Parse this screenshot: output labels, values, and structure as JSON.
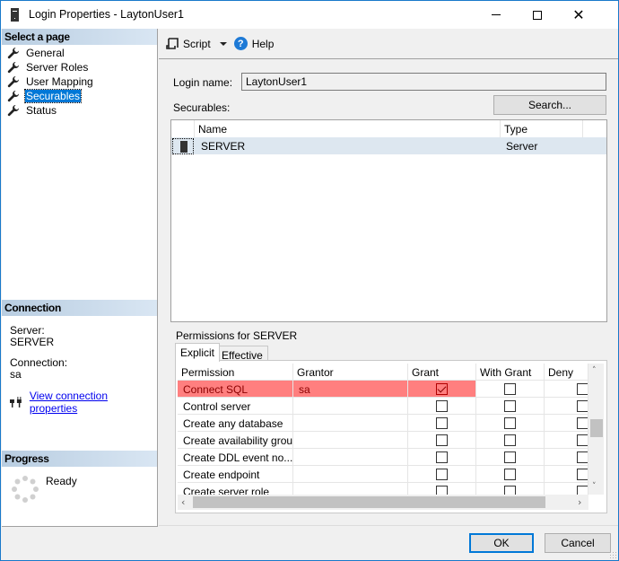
{
  "window": {
    "title": "Login Properties - LaytonUser1",
    "minimize_label": "Minimize",
    "maximize_label": "Maximize",
    "close_label": "Close"
  },
  "sidebar": {
    "select_page_heading": "Select a page",
    "items": [
      {
        "label": "General",
        "icon": "wrench-icon",
        "selected": false
      },
      {
        "label": "Server Roles",
        "icon": "wrench-icon",
        "selected": false
      },
      {
        "label": "User Mapping",
        "icon": "wrench-icon",
        "selected": false
      },
      {
        "label": "Securables",
        "icon": "wrench-icon",
        "selected": true
      },
      {
        "label": "Status",
        "icon": "wrench-icon",
        "selected": false
      }
    ],
    "connection": {
      "heading": "Connection",
      "server_label": "Server:",
      "server_value": "SERVER",
      "connection_label": "Connection:",
      "connection_value": "sa",
      "view_link": "View connection properties"
    },
    "progress": {
      "heading": "Progress",
      "status": "Ready"
    }
  },
  "toolbar": {
    "script_label": "Script",
    "help_label": "Help"
  },
  "form": {
    "login_name_label": "Login name:",
    "login_name_value": "LaytonUser1",
    "securables_label": "Securables:",
    "search_button": "Search..."
  },
  "securables_grid": {
    "columns": [
      "Name",
      "Type"
    ],
    "rows": [
      {
        "icon": "server-icon",
        "name": "SERVER",
        "type": "Server"
      }
    ]
  },
  "permissions": {
    "label": "Permissions for SERVER",
    "tabs": [
      {
        "label": "Explicit",
        "active": true
      },
      {
        "label": "Effective",
        "active": false
      }
    ],
    "columns": [
      "Permission",
      "Grantor",
      "Grant",
      "With Grant",
      "Deny"
    ],
    "rows": [
      {
        "permission": "Connect SQL",
        "grantor": "sa",
        "grant": true,
        "with_grant": false,
        "deny": false,
        "highlighted": true
      },
      {
        "permission": "Control server",
        "grantor": "",
        "grant": false,
        "with_grant": false,
        "deny": false,
        "highlighted": false
      },
      {
        "permission": "Create any database",
        "grantor": "",
        "grant": false,
        "with_grant": false,
        "deny": false,
        "highlighted": false
      },
      {
        "permission": "Create availability group",
        "grantor": "",
        "grant": false,
        "with_grant": false,
        "deny": false,
        "highlighted": false
      },
      {
        "permission": "Create DDL event no...",
        "grantor": "",
        "grant": false,
        "with_grant": false,
        "deny": false,
        "highlighted": false
      },
      {
        "permission": "Create endpoint",
        "grantor": "",
        "grant": false,
        "with_grant": false,
        "deny": false,
        "highlighted": false
      },
      {
        "permission": "Create server role",
        "grantor": "",
        "grant": false,
        "with_grant": false,
        "deny": false,
        "highlighted": false
      }
    ]
  },
  "buttons": {
    "ok": "OK",
    "cancel": "Cancel"
  },
  "colors": {
    "highlight_row": "#ff7f7f",
    "selection": "#0078d7",
    "link": "#0000ee"
  }
}
